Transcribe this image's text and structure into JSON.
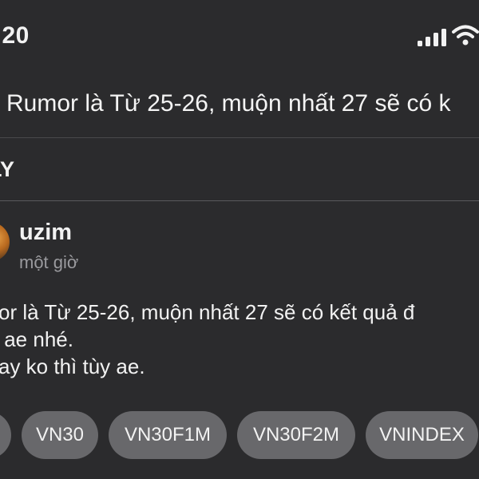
{
  "status_bar": {
    "time": ":20",
    "signal_icon": "cellular-signal-icon",
    "wifi_icon": "wifi-icon"
  },
  "header": {
    "title": "Rumor là Từ 25-26, muộn nhất 27 sẽ có k"
  },
  "section": {
    "label": "LY"
  },
  "post": {
    "author": "uzim",
    "time_ago": "một giờ",
    "lines": [
      "or là Từ 25-26, muộn nhất 27 sẽ có kết quả đ",
      " ae nhé.",
      "ay ko thì tùy ae."
    ],
    "tags": [
      "",
      "VN30",
      "VN30F1M",
      "VN30F2M",
      "VNINDEX"
    ]
  },
  "colors": {
    "background": "#2b2b2d",
    "tag_background": "#68686b",
    "muted_text": "#9a9a9e"
  }
}
